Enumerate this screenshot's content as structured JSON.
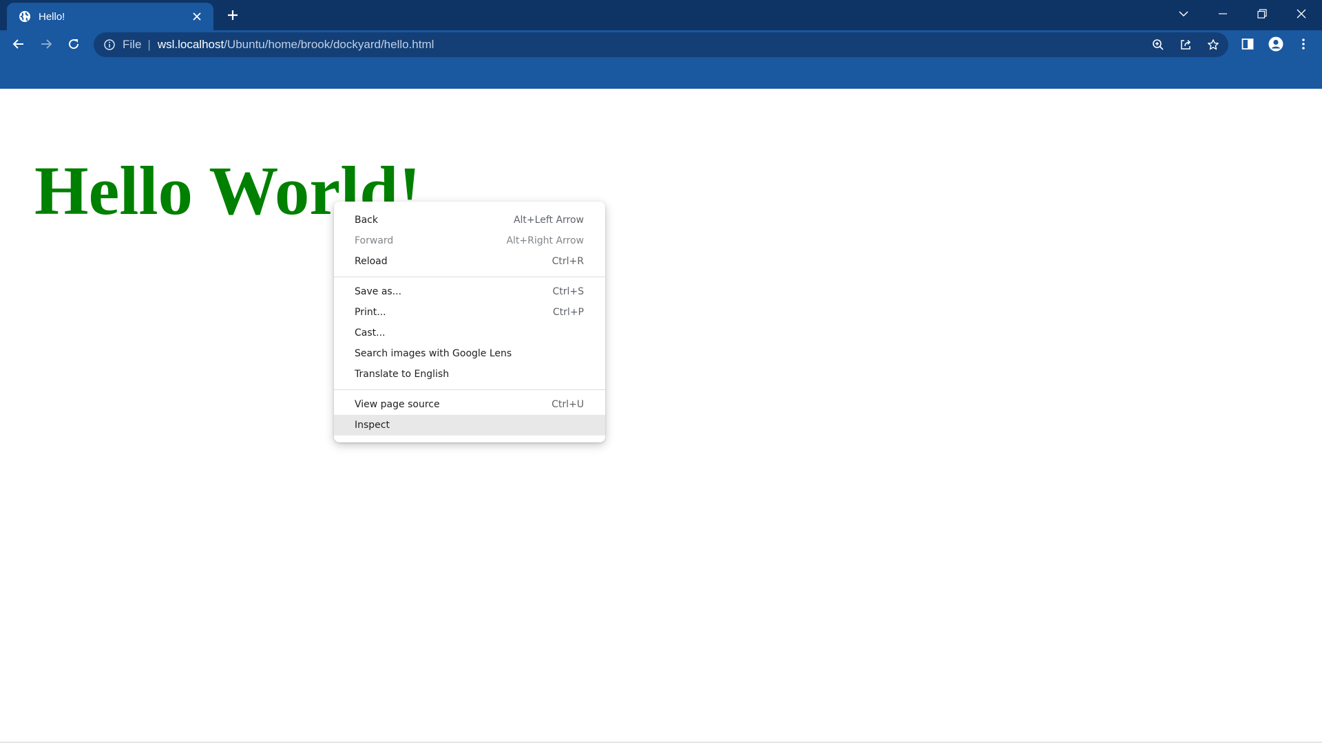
{
  "tab": {
    "title": "Hello!",
    "favicon": "globe-icon"
  },
  "omnibox": {
    "scheme": "File",
    "host": "wsl.localhost",
    "path": "/Ubuntu/home/brook/dockyard/hello.html"
  },
  "page": {
    "heading": "Hello World!"
  },
  "context_menu": {
    "groups": [
      [
        {
          "label": "Back",
          "shortcut": "Alt+Left Arrow",
          "enabled": true
        },
        {
          "label": "Forward",
          "shortcut": "Alt+Right Arrow",
          "enabled": false
        },
        {
          "label": "Reload",
          "shortcut": "Ctrl+R",
          "enabled": true
        }
      ],
      [
        {
          "label": "Save as...",
          "shortcut": "Ctrl+S",
          "enabled": true
        },
        {
          "label": "Print...",
          "shortcut": "Ctrl+P",
          "enabled": true
        },
        {
          "label": "Cast...",
          "shortcut": "",
          "enabled": true
        },
        {
          "label": "Search images with Google Lens",
          "shortcut": "",
          "enabled": true
        },
        {
          "label": "Translate to English",
          "shortcut": "",
          "enabled": true
        }
      ],
      [
        {
          "label": "View page source",
          "shortcut": "Ctrl+U",
          "enabled": true
        },
        {
          "label": "Inspect",
          "shortcut": "",
          "enabled": true,
          "hovered": true
        }
      ]
    ]
  },
  "colors": {
    "titlebar": "#0e3466",
    "toolbar": "#1a58a0",
    "heading": "#008000",
    "menu_hover": "#e8e8e8"
  }
}
